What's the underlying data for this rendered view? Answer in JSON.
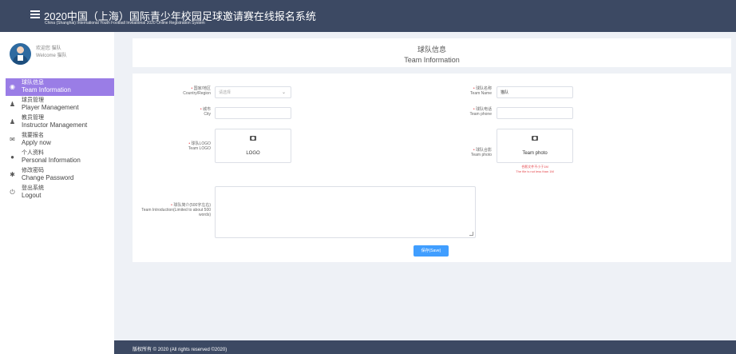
{
  "header": {
    "title_cn": "2020中国（上海）国际青少年校园足球邀请赛在线报名系统",
    "title_en": "China (Shanghai) International Youth Football Invitational 2020 Online Registration System"
  },
  "user": {
    "welcome_cn": "欢迎您 猫队",
    "welcome_en": "Welcome 猫队"
  },
  "sidebar": {
    "items": [
      {
        "cn": "球队信息",
        "en": "Team Information",
        "icon": "team-info-icon",
        "glyph": "◉"
      },
      {
        "cn": "球员管理",
        "en": "Player Management",
        "icon": "player-icon",
        "glyph": "♟"
      },
      {
        "cn": "教员管理",
        "en": "Instructor Management",
        "icon": "instructor-icon",
        "glyph": "♟"
      },
      {
        "cn": "我要报名",
        "en": "Apply now",
        "icon": "apply-icon",
        "glyph": "✉"
      },
      {
        "cn": "个人资料",
        "en": "Personal Information",
        "icon": "person-icon",
        "glyph": "●"
      },
      {
        "cn": "修改密码",
        "en": "Change Password",
        "icon": "gear-icon",
        "glyph": "✱"
      },
      {
        "cn": "登出系统",
        "en": "Logout",
        "icon": "logout-icon",
        "glyph": "⏻"
      }
    ]
  },
  "page": {
    "title_cn": "球队信息",
    "title_en": "Team Information"
  },
  "form": {
    "country": {
      "label_cn": "国家/地区",
      "label_en": "Country/Region",
      "placeholder": "请选择"
    },
    "team_name": {
      "label_cn": "球队名称",
      "label_en": "Team Name",
      "value": "猫队"
    },
    "city": {
      "label_cn": "城市",
      "label_en": "City",
      "value": ""
    },
    "team_phone": {
      "label_cn": "球队电话",
      "label_en": "Team phone",
      "value": ""
    },
    "team_logo": {
      "label_cn": "球队LOGO",
      "label_en": "Team LOGO",
      "upload_text": "LOGO"
    },
    "team_photo": {
      "label_cn": "球队合影",
      "label_en": "Team photo",
      "upload_text": "Team photo"
    },
    "photo_warning_cn": "合影文件不小于1M",
    "photo_warning_en": "The file is not less than 1M",
    "intro": {
      "label_cn": "球队简介(500字左右)",
      "label_en": "Team Introduction(Limited to about 500 words)",
      "value": ""
    },
    "save_label": "保存(Save)"
  },
  "footer": {
    "copyright": "版权所有 © 2020 (All rights reserved ©2020)"
  },
  "colors": {
    "header_bg": "#3c4963",
    "active_nav": "#9a7de6",
    "primary_button": "#409eff",
    "required_star": "#e5484d"
  }
}
